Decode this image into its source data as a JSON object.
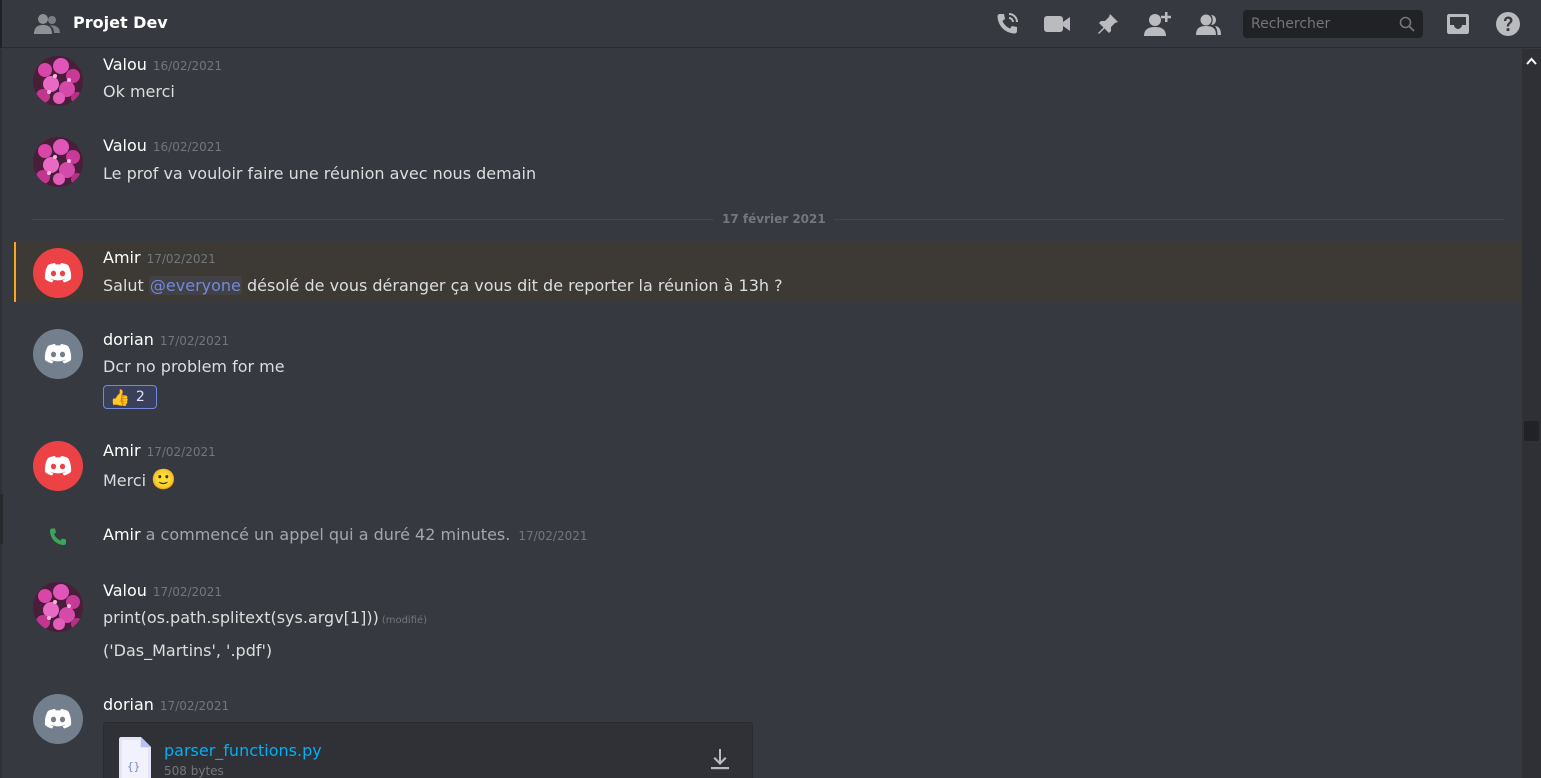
{
  "header": {
    "channel_title": "Projet Dev",
    "search_placeholder": "Rechercher"
  },
  "messages": [
    {
      "author": "Valou",
      "timestamp": "16/02/2021",
      "text": "Ok merci"
    },
    {
      "author": "Valou",
      "timestamp": "16/02/2021",
      "text": "Le prof va vouloir faire une réunion avec nous demain"
    }
  ],
  "date_divider": "17 février 2021",
  "mention_message": {
    "author": "Amir",
    "timestamp": "17/02/2021",
    "text_before": "Salut ",
    "mention": "@everyone",
    "text_after": " désolé de vous déranger ça vous dit de reporter la réunion à 13h ?"
  },
  "dorian_message": {
    "author": "dorian",
    "timestamp": "17/02/2021",
    "text": "Dcr no problem for me",
    "reaction_emoji": "👍",
    "reaction_count": "2"
  },
  "amir_merci": {
    "author": "Amir",
    "timestamp": "17/02/2021",
    "text": "Merci",
    "emoji": "🙂"
  },
  "call_event": {
    "author": "Amir",
    "text": "a commencé un appel qui a duré 42 minutes.",
    "timestamp": "17/02/2021"
  },
  "code_message": {
    "author": "Valou",
    "timestamp": "17/02/2021",
    "line1": "print(os.path.splitext(sys.argv[1]))",
    "edited": "(modifié)",
    "line2": "('Das_Martins', '.pdf')"
  },
  "file_message": {
    "author": "dorian",
    "timestamp": "17/02/2021",
    "file_name": "parser_functions.py",
    "file_size": "508 bytes"
  },
  "colors": {
    "background": "#36393f",
    "mention": "#7289da",
    "highlight_bar": "#faa61a",
    "avatar_red": "#ed4245",
    "avatar_grey": "#747f8d",
    "link": "#00b0f4",
    "call_green": "#3ba55c"
  }
}
